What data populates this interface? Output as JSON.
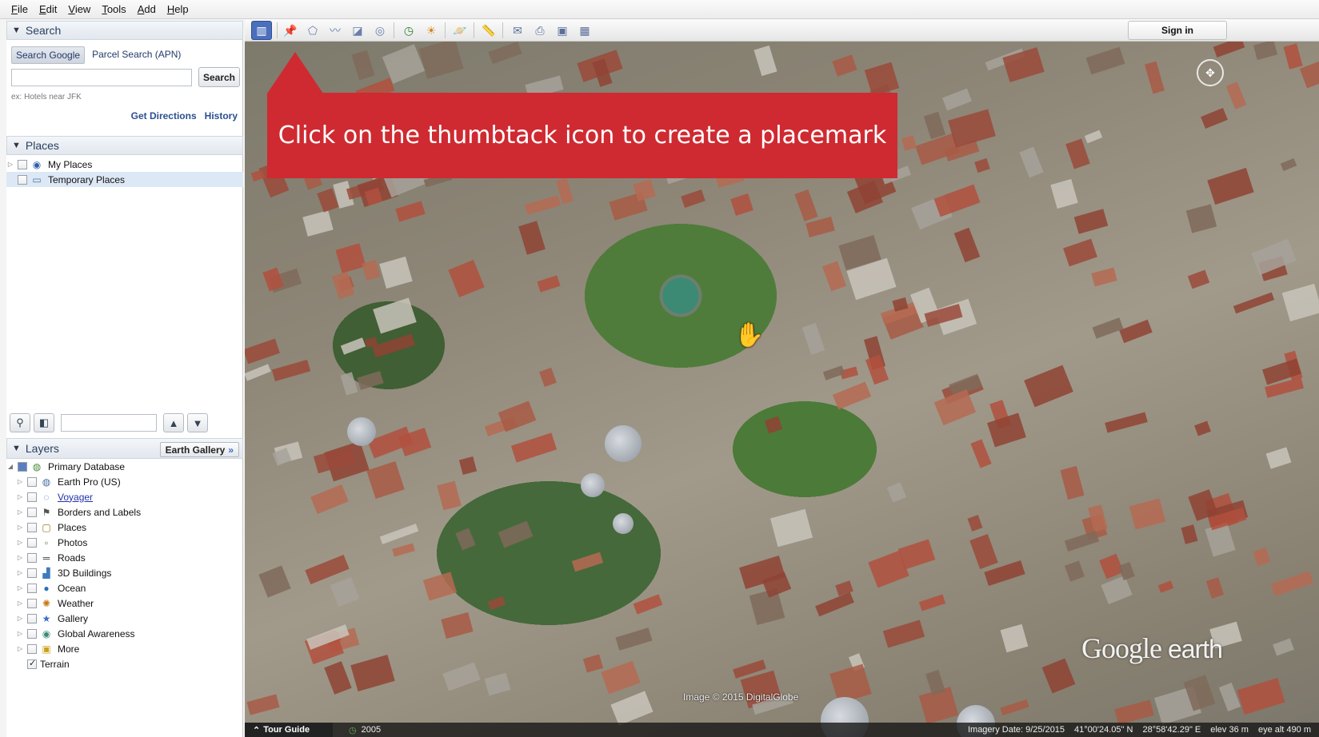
{
  "menu": [
    "File",
    "Edit",
    "View",
    "Tools",
    "Add",
    "Help"
  ],
  "search": {
    "header": "Search",
    "tabs": [
      "Search Google",
      "Parcel Search (APN)"
    ],
    "input_value": "",
    "button_label": "Search",
    "hint": "ex: Hotels near JFK",
    "links": [
      "Get Directions",
      "History"
    ]
  },
  "places": {
    "header": "Places",
    "items": [
      {
        "label": "My Places",
        "icon": "my-places-globe-icon",
        "checked": false
      },
      {
        "label": "Temporary Places",
        "icon": "folder-icon",
        "checked": false
      }
    ]
  },
  "layers": {
    "header": "Layers",
    "gallery_button": "Earth Gallery",
    "gallery_chevron": "»",
    "root": "Primary Database",
    "items": [
      {
        "label": "Earth Pro (US)",
        "icon": "earth-pro-icon",
        "checked": false
      },
      {
        "label": "Voyager",
        "icon": "voyager-icon",
        "checked": false,
        "link": true
      },
      {
        "label": "Borders and Labels",
        "icon": "flag-icon",
        "checked": false
      },
      {
        "label": "Places",
        "icon": "places-icon",
        "checked": false
      },
      {
        "label": "Photos",
        "icon": "photos-icon",
        "checked": false
      },
      {
        "label": "Roads",
        "icon": "roads-icon",
        "checked": false
      },
      {
        "label": "3D Buildings",
        "icon": "buildings-icon",
        "checked": false
      },
      {
        "label": "Ocean",
        "icon": "ocean-icon",
        "checked": false
      },
      {
        "label": "Weather",
        "icon": "weather-icon",
        "checked": false
      },
      {
        "label": "Gallery",
        "icon": "gallery-star-icon",
        "checked": false
      },
      {
        "label": "Global Awareness",
        "icon": "global-awareness-icon",
        "checked": false
      },
      {
        "label": "More",
        "icon": "more-icon",
        "checked": false
      },
      {
        "label": "Terrain",
        "icon": "",
        "checked": true
      }
    ]
  },
  "toolbar": {
    "signin_label": "Sign in",
    "buttons": [
      "sidebar",
      "placemark",
      "polygon",
      "path",
      "overlay",
      "record-tour",
      "historical-imagery",
      "sun",
      "planets",
      "ruler",
      "email",
      "print",
      "save-image",
      "view-in-maps"
    ]
  },
  "map": {
    "banner_text": "Click on the thumbtack icon to create a placemark",
    "logo_google": "Google",
    "logo_earth": "earth",
    "attribution": "Image © 2015 DigitalGlobe"
  },
  "status": {
    "tour_guide": "Tour Guide",
    "year": "2005",
    "imagery_date": "Imagery Date: 9/25/2015",
    "lat": "41°00'24.05\" N",
    "lon": "28°58'42.29\" E",
    "elev": "elev   36 m",
    "eye_alt": "eye alt   490 m"
  },
  "colors": {
    "banner": "#cf2a31",
    "accent": "#4a6fbd"
  }
}
